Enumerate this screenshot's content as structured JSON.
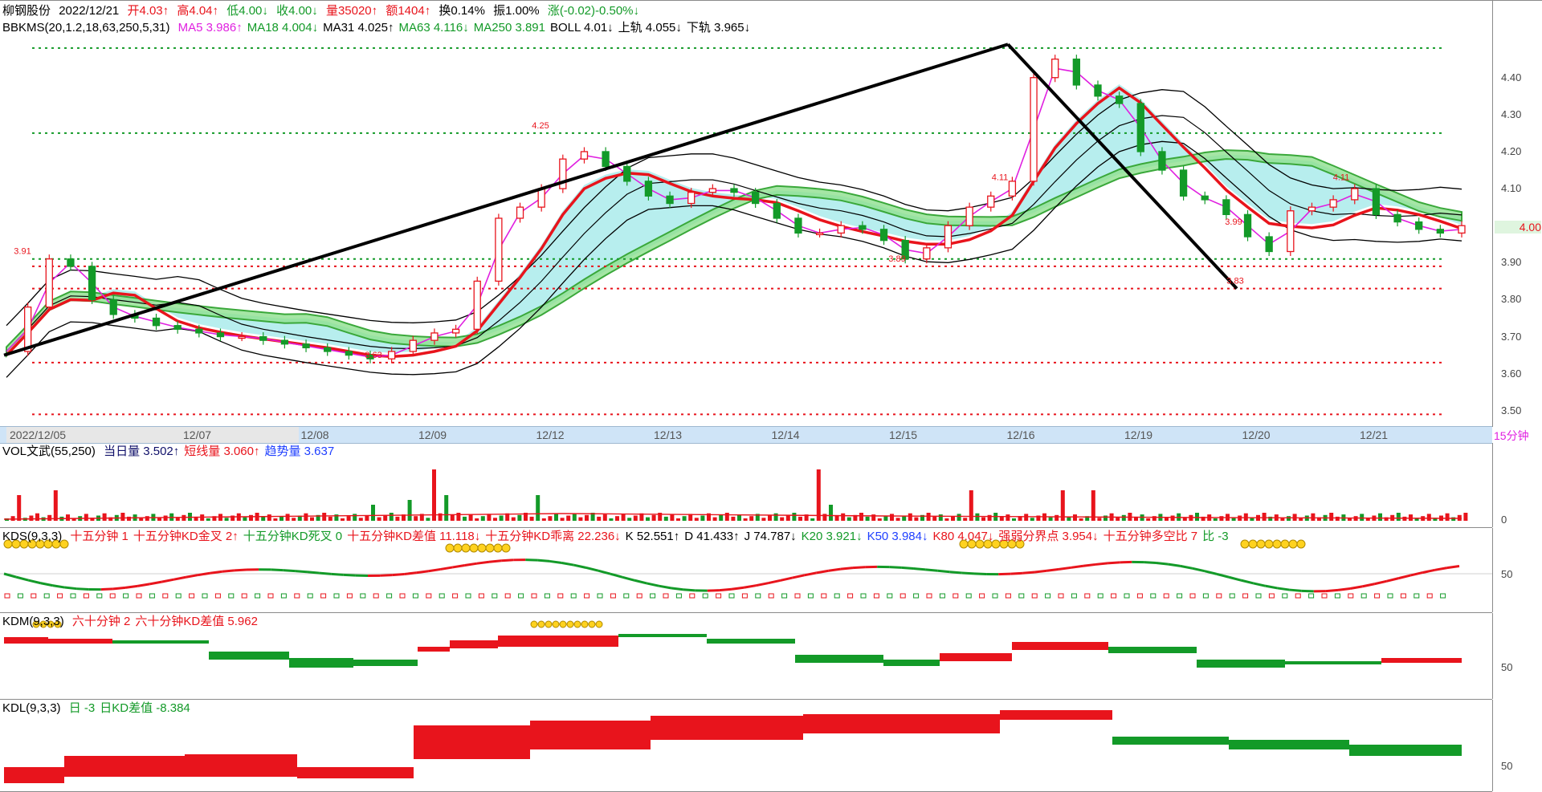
{
  "header": {
    "name": "柳钢股份",
    "date": "2022/12/21",
    "open": "开4.03↑",
    "high": "高4.04↑",
    "low": "低4.00↓",
    "close": "收4.00↓",
    "volume": "量35020↑",
    "amount": "额1404↑",
    "turnover": "换0.14%",
    "amplitude": "振1.00%",
    "change": "涨(-0.02)-0.50%↓"
  },
  "main_indicator": {
    "name": "BBKMS(20,1.2,18,63,250,5,31)",
    "items": [
      {
        "text": "MA5 3.986↑",
        "color": "#e020e0"
      },
      {
        "text": "MA18 4.004↓",
        "color": "#139a28"
      },
      {
        "text": "MA31 4.025↑",
        "color": "#000000"
      },
      {
        "text": "MA63 4.116↓",
        "color": "#139a28"
      },
      {
        "text": "MA250 3.891",
        "color": "#139a28"
      },
      {
        "text": "BOLL 4.01↓",
        "color": "#000000"
      },
      {
        "text": "上轨 4.055↓",
        "color": "#000000"
      },
      {
        "text": "下轨 3.965↓",
        "color": "#000000"
      }
    ]
  },
  "vol_indicator": {
    "name": "VOL文武(55,250)",
    "items": [
      {
        "text": "当日量 3.502↑",
        "color": "#10106a"
      },
      {
        "text": "短线量 3.060↑",
        "color": "#e8141c"
      },
      {
        "text": "趋势量 3.637",
        "color": "#2040ff"
      }
    ]
  },
  "kds_indicator": {
    "name": "KDS(9,3,3)",
    "items": [
      {
        "text": "十五分钟 1",
        "color": "#e8141c"
      },
      {
        "text": "十五分钟KD金叉 2↑",
        "color": "#e8141c"
      },
      {
        "text": "十五分钟KD死叉 0",
        "color": "#139a28"
      },
      {
        "text": "十五分钟KD差值 11.118↓",
        "color": "#e8141c"
      },
      {
        "text": "十五分钟KD乖离 22.236↓",
        "color": "#e8141c"
      },
      {
        "text": "K 52.551↑",
        "color": "#000000"
      },
      {
        "text": "D 41.433↑",
        "color": "#000000"
      },
      {
        "text": "J 74.787↓",
        "color": "#000000"
      },
      {
        "text": "K20 3.921↓",
        "color": "#139a28"
      },
      {
        "text": "K50 3.984↓",
        "color": "#2040ff"
      },
      {
        "text": "K80 4.047↓",
        "color": "#e8141c"
      },
      {
        "text": "强弱分界点 3.954↓",
        "color": "#e8141c"
      },
      {
        "text": "十五分钟多空比 7",
        "color": "#e8141c"
      },
      {
        "text": "比 -3",
        "color": "#139a28"
      }
    ]
  },
  "kdm_indicator": {
    "name": "KDM(9,3,3)",
    "items": [
      {
        "text": "六十分钟 2",
        "color": "#e8141c"
      },
      {
        "text": "六十分钟KD差值 5.962",
        "color": "#e8141c"
      }
    ]
  },
  "kdl_indicator": {
    "name": "KDL(9,3,3)",
    "items": [
      {
        "text": "日 -3",
        "color": "#139a28"
      },
      {
        "text": "日KD差值 -8.384",
        "color": "#139a28"
      }
    ]
  },
  "period_label": "15分钟",
  "current_price": "4.00",
  "chart_data": {
    "type": "candlestick",
    "symbol": "柳钢股份",
    "x_tick_labels": [
      "2022/12/05",
      "12/07",
      "12/08",
      "12/09",
      "12/12",
      "12/13",
      "12/14",
      "12/15",
      "12/16",
      "12/19",
      "12/20",
      "12/21"
    ],
    "y_tick_labels": [
      "4.40",
      "4.30",
      "4.20",
      "4.10",
      "4.00",
      "3.90",
      "3.80",
      "3.70",
      "3.60",
      "3.50"
    ],
    "ylim": [
      3.48,
      4.51
    ],
    "price_annotations": [
      {
        "label": "3.91",
        "value": 3.91
      },
      {
        "label": "4.25",
        "value": 4.25
      },
      {
        "label": "3.63",
        "value": 3.63
      },
      {
        "label": "3.89",
        "value": 3.89
      },
      {
        "label": "4.11",
        "value": 4.11
      },
      {
        "label": "3.83",
        "value": 3.83
      },
      {
        "label": "3.99",
        "value": 3.99
      },
      {
        "label": "4.11",
        "value": 4.11
      }
    ],
    "horizontal_levels": [
      {
        "value": 4.48,
        "color": "#139a28"
      },
      {
        "value": 4.25,
        "color": "#139a28"
      },
      {
        "value": 3.91,
        "color": "#139a28"
      },
      {
        "value": 3.89,
        "color": "#e8141c"
      },
      {
        "value": 3.83,
        "color": "#e8141c"
      },
      {
        "value": 3.63,
        "color": "#e8141c"
      },
      {
        "value": 3.49,
        "color": "#e8141c"
      }
    ],
    "close_path": [
      3.66,
      3.78,
      3.91,
      3.89,
      3.8,
      3.76,
      3.75,
      3.73,
      3.72,
      3.71,
      3.7,
      3.7,
      3.69,
      3.68,
      3.67,
      3.66,
      3.65,
      3.64,
      3.66,
      3.69,
      3.71,
      3.72,
      3.85,
      4.02,
      4.05,
      4.1,
      4.18,
      4.2,
      4.16,
      4.12,
      4.08,
      4.06,
      4.09,
      4.1,
      4.09,
      4.06,
      4.02,
      3.98,
      3.98,
      4.0,
      3.99,
      3.96,
      3.91,
      3.94,
      4.0,
      4.05,
      4.08,
      4.12,
      4.4,
      4.45,
      4.38,
      4.35,
      4.33,
      4.2,
      4.15,
      4.08,
      4.07,
      4.03,
      3.97,
      3.93,
      4.04,
      4.05,
      4.07,
      4.1,
      4.03,
      4.01,
      3.99,
      3.98,
      4.0
    ],
    "vol_axis_label": "0",
    "kds_axis_label": "50",
    "kdm_axis_label": "50",
    "kdl_axis_label": "50"
  }
}
